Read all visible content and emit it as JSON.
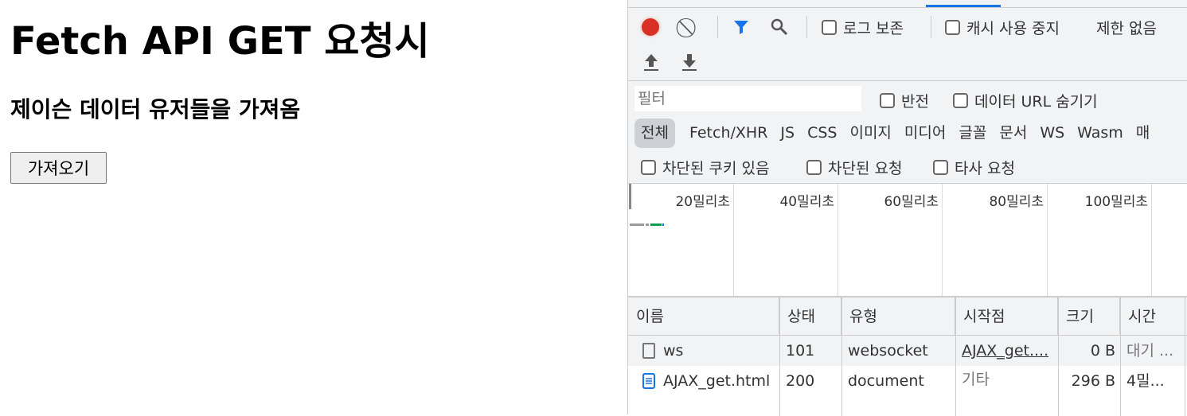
{
  "page": {
    "title": "Fetch API GET 요청시",
    "subtitle": "제이슨 데이터 유저들을 가져옴",
    "button": "가져오기"
  },
  "devtools": {
    "toolbar": {
      "preserve_log": "로그 보존",
      "disable_cache": "캐시 사용 중지",
      "throttle": "제한 없음"
    },
    "filter": {
      "placeholder": "필터",
      "invert": "반전",
      "hide_data_urls": "데이터 URL 숨기기"
    },
    "types": [
      "전체",
      "Fetch/XHR",
      "JS",
      "CSS",
      "이미지",
      "미디어",
      "글꼴",
      "문서",
      "WS",
      "Wasm",
      "매"
    ],
    "checks": {
      "blocked_cookies": "차단된 쿠키 있음",
      "blocked_requests": "차단된 요청",
      "third_party": "타사 요청"
    },
    "timeline_ticks": [
      "20밀리초",
      "40밀리초",
      "60밀리초",
      "80밀리초",
      "100밀리초"
    ],
    "columns": [
      "이름",
      "상태",
      "유형",
      "시작점",
      "크기",
      "시간"
    ],
    "rows": [
      {
        "name": "ws",
        "status": "101",
        "type": "websocket",
        "initiator": "AJAX_get....",
        "size": "0 B",
        "time": "대기 ..."
      },
      {
        "name": "AJAX_get.html",
        "status": "200",
        "type": "document",
        "initiator": "기타",
        "size": "296 B",
        "time": "4밀..."
      }
    ],
    "colors": {
      "record": "#d93025",
      "accent": "#1a73e8"
    }
  }
}
